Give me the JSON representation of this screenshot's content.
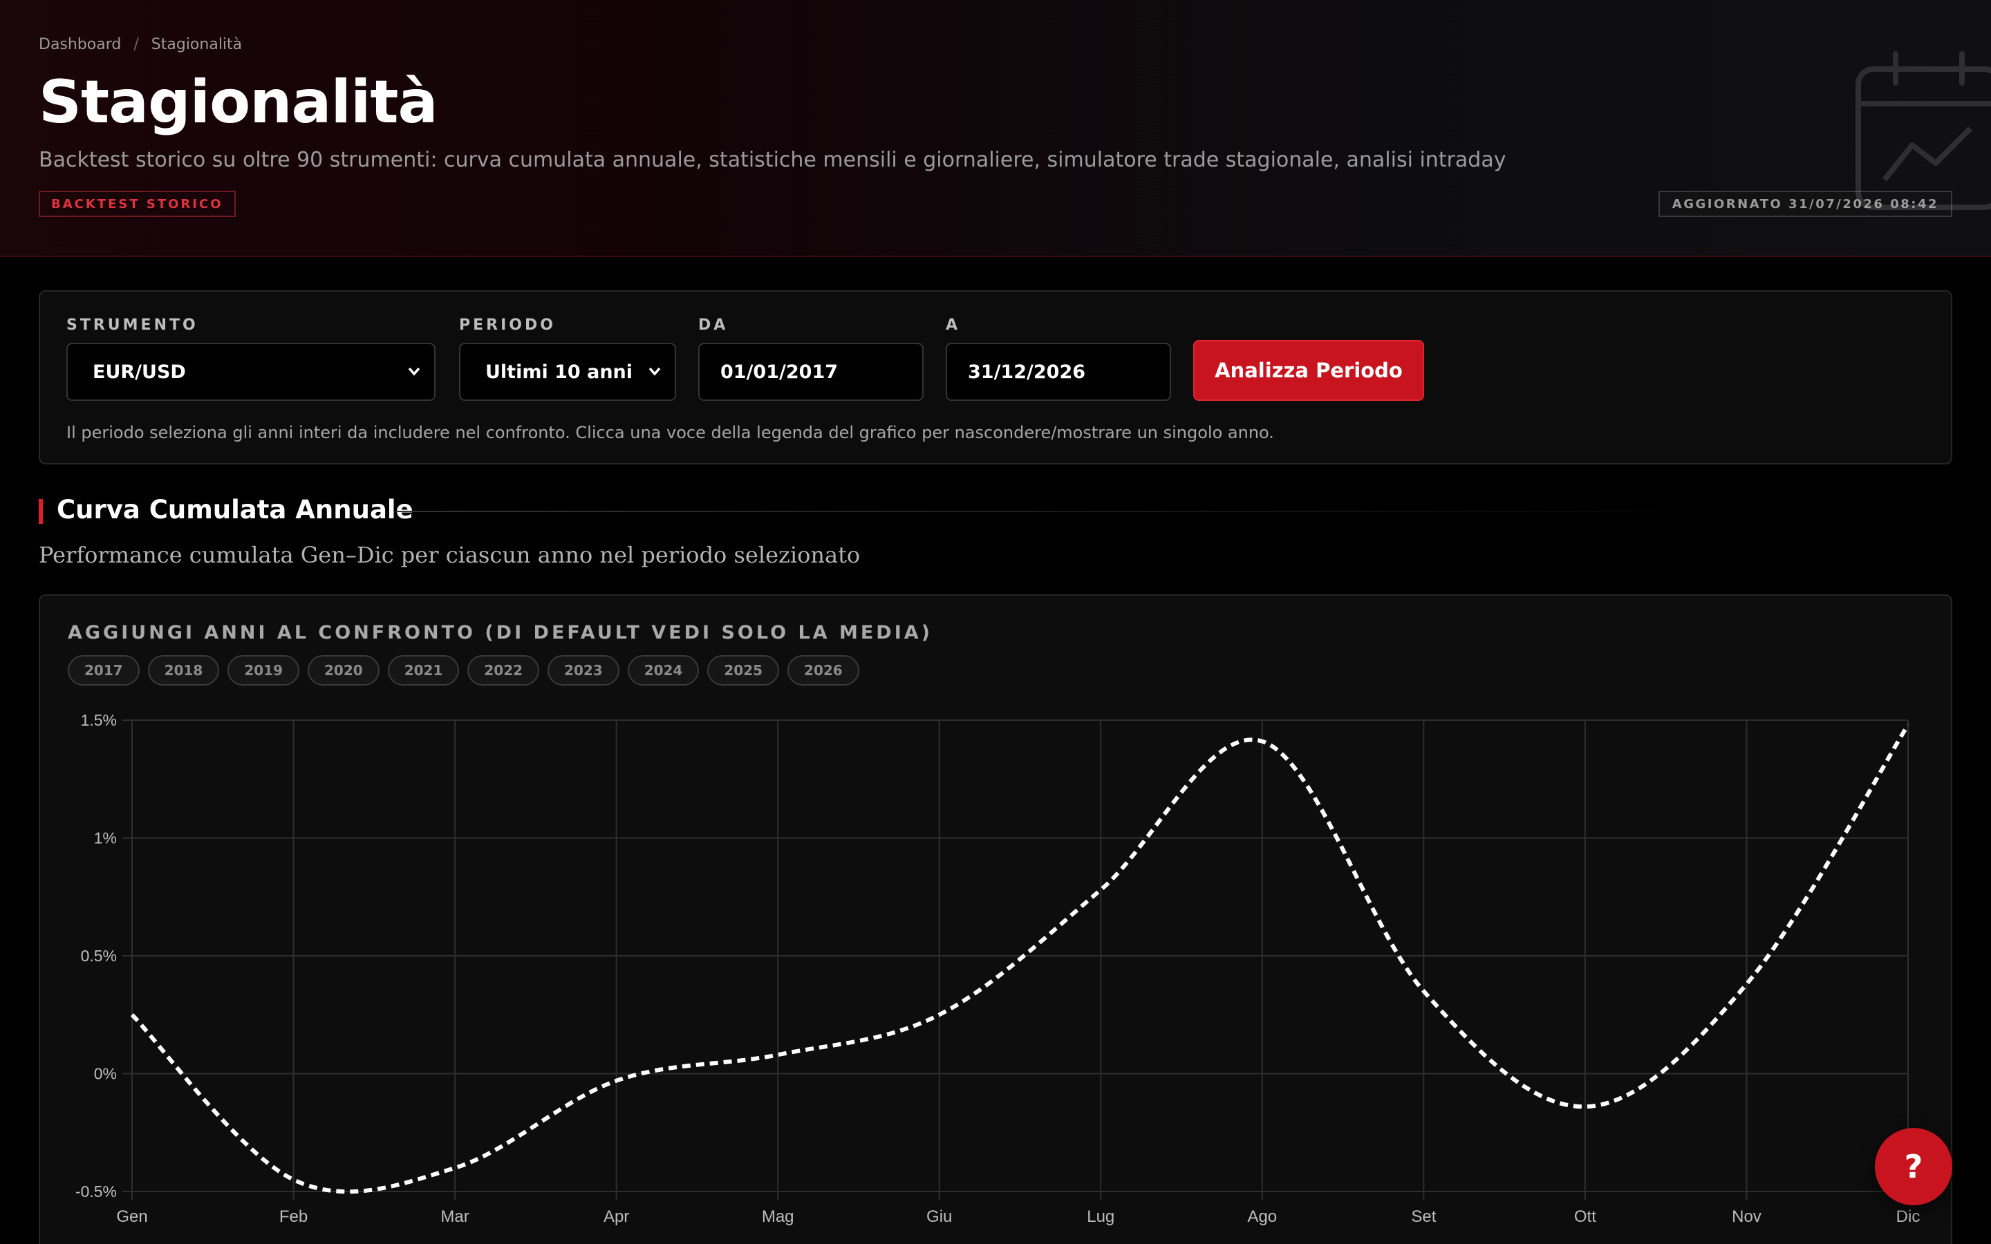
{
  "breadcrumb": {
    "root": "Dashboard",
    "separator": "/",
    "current": "Stagionalità"
  },
  "header": {
    "title": "Stagionalità",
    "subtitle": "Backtest storico su oltre 90 strumenti: curva cumulata annuale, statistiche mensili e giornaliere, simulatore trade stagionale, analisi intraday",
    "badge": "BACKTEST STORICO",
    "updated": "AGGIORNATO 31/07/2026 08:42",
    "deco_icon": "calendar-chart-icon"
  },
  "filters": {
    "instrument_label": "STRUMENTO",
    "instrument_value": "EUR/USD",
    "period_label": "PERIODO",
    "period_value": "Ultimi 10 anni",
    "from_label": "DA",
    "from_value": "01/01/2017",
    "to_label": "A",
    "to_value": "31/12/2026",
    "analyze_button": "Analizza Periodo",
    "hint": "Il periodo seleziona gli anni interi da includere nel confronto. Clicca una voce della legenda del grafico per nascondere/mostrare un singolo anno."
  },
  "section": {
    "title": "Curva Cumulata Annuale",
    "description": "Performance cumulata Gen–Dic per ciascun anno nel periodo selezionato"
  },
  "chart_card": {
    "years_label": "AGGIUNGI ANNI AL CONFRONTO (DI DEFAULT VEDI SOLO LA MEDIA)",
    "years": [
      "2017",
      "2018",
      "2019",
      "2020",
      "2021",
      "2022",
      "2023",
      "2024",
      "2025",
      "2026"
    ]
  },
  "colors": {
    "accent": "#c8141f",
    "average_line": "#ffffff",
    "grid": "#2e2e2e",
    "background": "#000000"
  },
  "help_button": {
    "label": "?"
  },
  "chart_data": {
    "type": "line",
    "categories": [
      "Gen",
      "Feb",
      "Mar",
      "Apr",
      "Mag",
      "Giu",
      "Lug",
      "Ago",
      "Set",
      "Ott",
      "Nov",
      "Dic"
    ],
    "series": [
      {
        "values": [
          0.25,
          -0.45,
          -0.4,
          -0.03,
          0.08,
          0.25,
          0.78,
          1.41,
          0.35,
          -0.14,
          0.38,
          1.48
        ]
      }
    ],
    "yticks": [
      -0.5,
      0,
      0.5,
      1,
      1.5
    ],
    "ytick_labels": [
      "-0.5%",
      "0%",
      "0.5%",
      "1%",
      "1.5%"
    ],
    "ylim": [
      -0.5,
      1.5
    ],
    "grid": true,
    "line_style": "dashed"
  }
}
